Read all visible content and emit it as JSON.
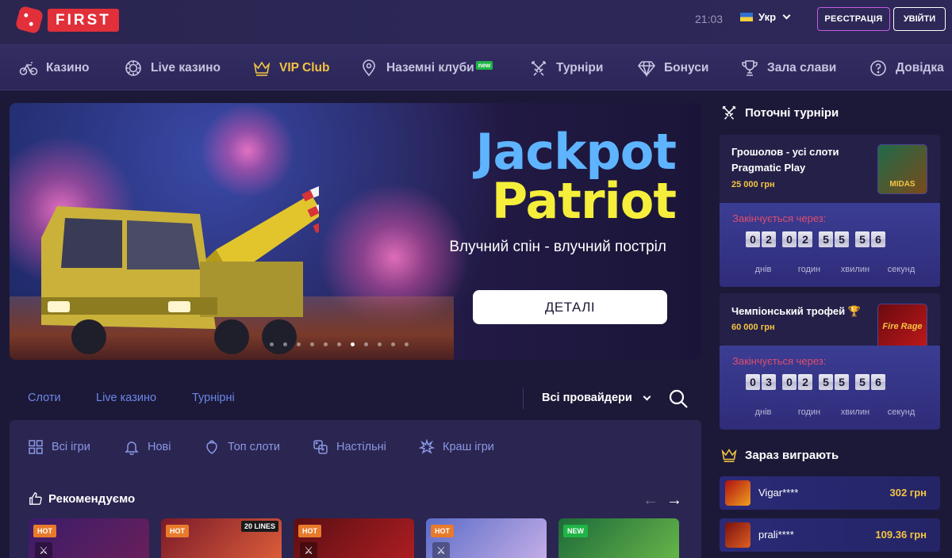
{
  "header": {
    "logo_text": "FIRST",
    "time": "21:03",
    "lang": "Укр",
    "register_label": "РЕЄСТРАЦІЯ",
    "login_label": "УВІЙТИ"
  },
  "nav": {
    "items": [
      {
        "label": "Казино",
        "icon": "bike-icon"
      },
      {
        "label": "Live казино",
        "icon": "chip-icon"
      },
      {
        "label": "VIP Club",
        "icon": "crown-icon"
      },
      {
        "label": "Наземні клуби",
        "icon": "map-pin-icon",
        "badge": "new"
      },
      {
        "label": "Турніри",
        "icon": "swords-icon"
      },
      {
        "label": "Бонуси",
        "icon": "diamond-icon"
      },
      {
        "label": "Зала слави",
        "icon": "trophy-icon"
      },
      {
        "label": "Довідка",
        "icon": "help-icon"
      }
    ]
  },
  "banner": {
    "title_line1": "Jackpot",
    "title_line2": "Patriot",
    "tagline": "Влучний спін - влучний постріл",
    "button": "ДЕТАЛІ",
    "slides": 11,
    "active_slide": 6,
    "colors": {
      "title1": "#5fb4ff",
      "title2": "#f5ee3a"
    }
  },
  "category_tabs": [
    "Слоти",
    "Live казино",
    "Турнірні"
  ],
  "providers_label": "Всі провайдери",
  "filters": [
    {
      "label": "Всі ігри",
      "icon": "grid-icon"
    },
    {
      "label": "Нові",
      "icon": "bell-icon"
    },
    {
      "label": "Топ слоти",
      "icon": "strawberry-icon"
    },
    {
      "label": "Настільні",
      "icon": "dice-icon"
    },
    {
      "label": "Краш ігри",
      "icon": "explosion-icon"
    }
  ],
  "recommended": {
    "title": "Рекомендуємо",
    "games": [
      {
        "badge": "HOT"
      },
      {
        "badge": "HOT",
        "extra": "20 LINES"
      },
      {
        "badge": "HOT"
      },
      {
        "badge": "HOT"
      },
      {
        "badge": "NEW"
      }
    ]
  },
  "sidebar": {
    "tournaments_title": "Поточні турніри",
    "tournaments": [
      {
        "name": "Грошолов - усі слоти Pragmatic Play",
        "prize": "25 000 грн",
        "ends_label": "Закінчується через:",
        "days": "02",
        "hours": "02",
        "minutes": "55",
        "seconds": "56",
        "thumb_text": "MIDAS"
      },
      {
        "name": "Чемпіонський трофей 🏆",
        "prize": "60 000 грн",
        "ends_label": "Закінчується через:",
        "days": "03",
        "hours": "02",
        "minutes": "55",
        "seconds": "56",
        "thumb_text": "Fire Rage"
      }
    ],
    "units": [
      "днів",
      "годин",
      "хвилин",
      "секунд"
    ],
    "winners_title": "Зараз виграють",
    "winners": [
      {
        "name": "Vigar****",
        "amount": "302 грн"
      },
      {
        "name": "prali****",
        "amount": "109.36 грн"
      }
    ]
  }
}
